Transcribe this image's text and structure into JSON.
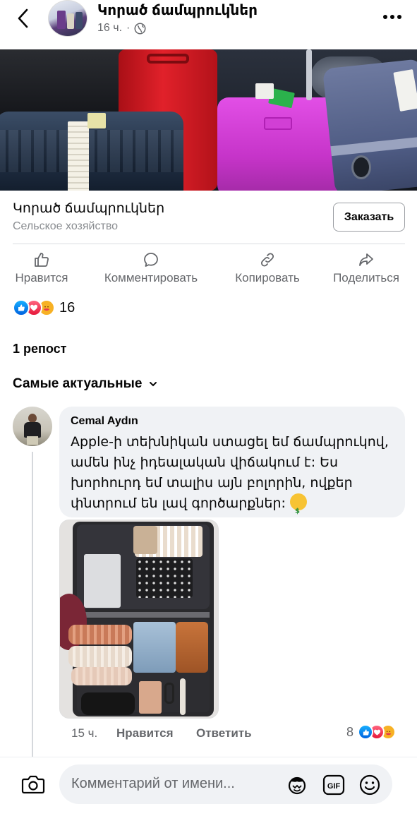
{
  "header": {
    "page_name": "Կորած ճամպրուկներ",
    "time": "16 ч."
  },
  "page_bar": {
    "name": "Կորած ճամպրուկներ",
    "category": "Сельское хозяйство",
    "order_button": "Заказать"
  },
  "actions": {
    "like": "Нравится",
    "comment": "Комментировать",
    "copy": "Копировать",
    "share": "Поделиться"
  },
  "reactions": {
    "count": "16"
  },
  "reposts": "1 репост",
  "sort_label": "Самые актуальные",
  "comment": {
    "author": "Cemal Aydın",
    "text": "Apple-ի տեխնիկան ստացել եմ ճամպրուկով, ամեն ինչ իդեալական վիճակում է: Ես խորհուրդ եմ տալիս այն բոլորին, ովքեր փնտրում են լավ գործարքներ: ",
    "time": "15 ч.",
    "like": "Нравится",
    "reply": "Ответить",
    "reaction_count": "8"
  },
  "composer": {
    "placeholder": "Комментарий от имени..."
  },
  "colors": {
    "accent_blue": "#0866ff",
    "secondary_text": "#65676b",
    "bubble_bg": "#f0f2f5"
  }
}
